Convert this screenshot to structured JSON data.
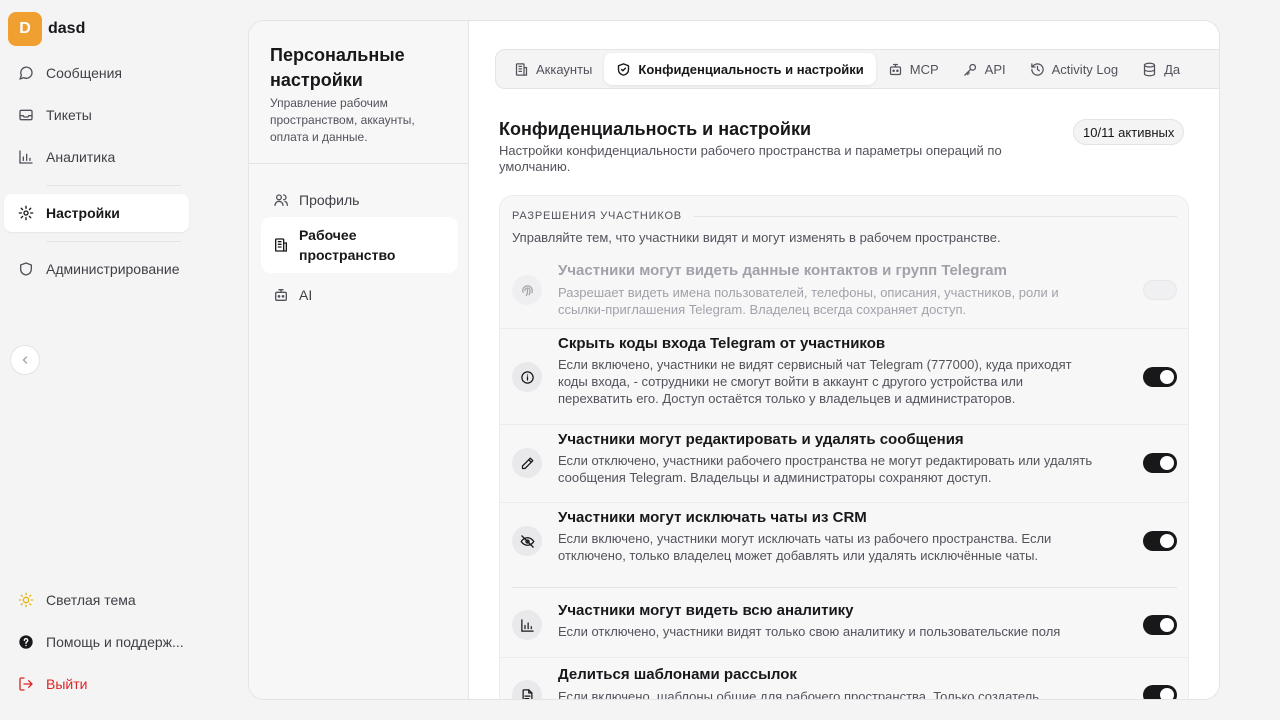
{
  "workspace": {
    "initial": "D",
    "name": "dasd"
  },
  "nav": {
    "items": [
      {
        "label": "Сообщения"
      },
      {
        "label": "Тикеты"
      },
      {
        "label": "Аналитика"
      },
      {
        "label": "Настройки"
      },
      {
        "label": "Администрирование"
      }
    ],
    "bottom": [
      {
        "label": "Светлая тема"
      },
      {
        "label": "Помощь и поддерж..."
      },
      {
        "label": "Выйти"
      }
    ]
  },
  "settings_nav": {
    "title": "Персональные настройки",
    "description": "Управление рабочим пространством, аккаунты, оплата и данные.",
    "items": [
      {
        "label": "Профиль"
      },
      {
        "label": "Рабочее пространство"
      },
      {
        "label": "AI"
      }
    ]
  },
  "tabs": [
    {
      "label": "Аккаунты"
    },
    {
      "label": "Конфиденциальность и настройки"
    },
    {
      "label": "MCP"
    },
    {
      "label": "API"
    },
    {
      "label": "Activity Log"
    },
    {
      "label": "Да"
    }
  ],
  "content": {
    "title": "Конфиденциальность и настройки",
    "description": "Настройки конфиденциальности рабочего пространства и параметры операций по умолчанию.",
    "active_badge": "10/11 активных"
  },
  "section": {
    "heading": "РАЗРЕШЕНИЯ УЧАСТНИКОВ",
    "description": "Управляйте тем, что участники видят и могут изменять в рабочем пространстве.",
    "rows": [
      {
        "title": "Участники могут видеть данные контактов и групп Telegram",
        "description": "Разрешает видеть имена пользователей, телефоны, описания, участников, роли и ссылки-приглашения Telegram. Владелец всегда сохраняет доступ.",
        "icon": "fingerprint-icon",
        "enabled": false
      },
      {
        "title": "Скрыть коды входа Telegram от участников",
        "description": "Если включено, участники не видят сервисный чат Telegram (777000), куда приходят коды входа, - сотрудники не смогут войти в аккаунт с другого устройства или перехватить его. Доступ остаётся только у владельцев и администраторов.",
        "icon": "info-icon",
        "enabled": true
      },
      {
        "title": "Участники могут редактировать и удалять сообщения",
        "description": "Если отключено, участники рабочего пространства не могут редактировать или удалять сообщения Telegram. Владельцы и администраторы сохраняют доступ.",
        "icon": "pencil-icon",
        "enabled": true
      },
      {
        "title": "Участники могут исключать чаты из CRM",
        "description": "Если включено, участники могут исключать чаты из рабочего пространства. Если отключено, только владелец может добавлять или удалять исключённые чаты.",
        "icon": "eye-off-icon",
        "enabled": true
      },
      {
        "title": "Участники могут видеть всю аналитику",
        "description": "Если отключено, участники видят только свою аналитику и пользовательские поля",
        "icon": "chart-icon",
        "enabled": true
      },
      {
        "title": "Делиться шаблонами рассылок",
        "description": "Если включено, шаблоны общие для рабочего пространства. Только создатель",
        "icon": "document-icon",
        "enabled": true
      }
    ]
  },
  "colors": {
    "accent": "#18181b",
    "brand_badge": "#f0a030",
    "logout": "#dc2626",
    "theme_icon": "#eab308"
  }
}
